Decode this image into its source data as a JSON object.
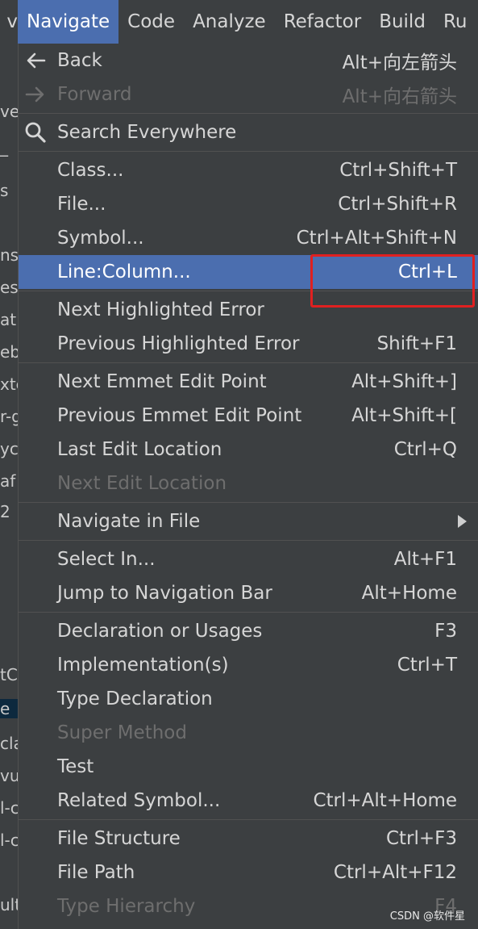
{
  "menubar": {
    "items": [
      "v",
      "Navigate",
      "Code",
      "Analyze",
      "Refactor",
      "Build",
      "Ru"
    ]
  },
  "background_fragments": [
    "ve",
    "_",
    "s",
    "ns",
    "es",
    "at",
    "eb",
    "xte",
    "r-g",
    "yc",
    "af",
    "2",
    "tC",
    "e",
    "cla",
    "vu",
    "l-c",
    "l-c",
    "ult"
  ],
  "menu": {
    "back": {
      "label": "Back",
      "shortcut": "Alt+向左箭头"
    },
    "forward": {
      "label": "Forward",
      "shortcut": "Alt+向右箭头"
    },
    "search": {
      "label": "Search Everywhere"
    },
    "class": {
      "label": "Class...",
      "shortcut": "Ctrl+Shift+T"
    },
    "file": {
      "label": "File...",
      "shortcut": "Ctrl+Shift+R"
    },
    "symbol": {
      "label": "Symbol...",
      "shortcut": "Ctrl+Alt+Shift+N"
    },
    "line_column": {
      "label": "Line:Column...",
      "shortcut": "Ctrl+L"
    },
    "next_error": {
      "label": "Next Highlighted Error"
    },
    "prev_error": {
      "label": "Previous Highlighted Error",
      "shortcut": "Shift+F1"
    },
    "next_emmet": {
      "label": "Next Emmet Edit Point",
      "shortcut": "Alt+Shift+]"
    },
    "prev_emmet": {
      "label": "Previous Emmet Edit Point",
      "shortcut": "Alt+Shift+["
    },
    "last_edit": {
      "label": "Last Edit Location",
      "shortcut": "Ctrl+Q"
    },
    "next_edit": {
      "label": "Next Edit Location"
    },
    "navigate_in_file": {
      "label": "Navigate in File"
    },
    "select_in": {
      "label": "Select In...",
      "shortcut": "Alt+F1"
    },
    "jump_nav": {
      "label": "Jump to Navigation Bar",
      "shortcut": "Alt+Home"
    },
    "declaration": {
      "label": "Declaration or Usages",
      "shortcut": "F3"
    },
    "implementation": {
      "label": "Implementation(s)",
      "shortcut": "Ctrl+T"
    },
    "type_decl": {
      "label": "Type Declaration"
    },
    "super_method": {
      "label": "Super Method"
    },
    "test": {
      "label": "Test"
    },
    "related": {
      "label": "Related Symbol...",
      "shortcut": "Ctrl+Alt+Home"
    },
    "file_structure": {
      "label": "File Structure",
      "shortcut": "Ctrl+F3"
    },
    "file_path": {
      "label": "File Path",
      "shortcut": "Ctrl+Alt+F12"
    },
    "type_hierarchy": {
      "label": "Type Hierarchy",
      "shortcut": "F4"
    }
  },
  "watermark": "CSDN @软件星",
  "colors": {
    "selection": "#4b6eaf",
    "annotation": "#e02020",
    "background": "#3c3f41"
  }
}
